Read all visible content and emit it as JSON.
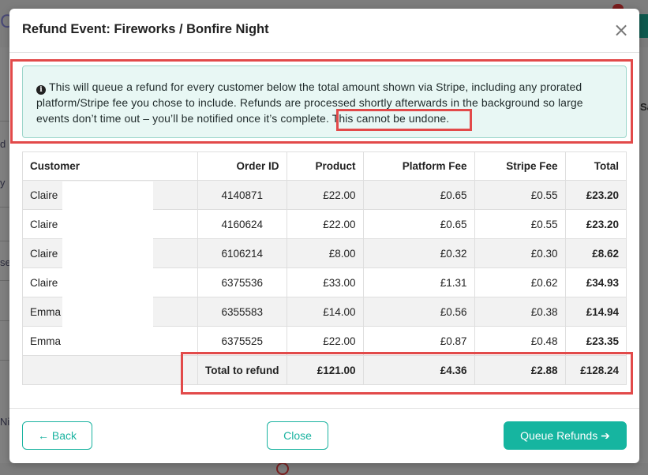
{
  "background": {
    "logo_letter": "C",
    "right_partial_text": "Sa",
    "left_partial_texts": [
      "d",
      "y",
      "se",
      "Ni"
    ]
  },
  "modal": {
    "title": "Refund Event: Fireworks / Bonfire Night",
    "close_icon": "×"
  },
  "alert": {
    "icon": "info-circle-icon",
    "text": "This will queue a refund for every customer below the total amount shown via Stripe, including any prorated platform/Stripe fee you chose to include. Refunds are processed shortly afterwards in the background so large events don’t time out – you’ll be notified once it’s complete.",
    "warning": "This cannot be undone."
  },
  "table": {
    "headers": [
      "Customer",
      "Order ID",
      "Product",
      "Platform Fee",
      "Stripe Fee",
      "Total"
    ],
    "rows": [
      {
        "customer": "Claire",
        "order_id": "4140871",
        "product": "£22.00",
        "platform_fee": "£0.65",
        "stripe_fee": "£0.55",
        "total": "£23.20"
      },
      {
        "customer": "Claire",
        "order_id": "4160624",
        "product": "£22.00",
        "platform_fee": "£0.65",
        "stripe_fee": "£0.55",
        "total": "£23.20"
      },
      {
        "customer": "Claire",
        "order_id": "6106214",
        "product": "£8.00",
        "platform_fee": "£0.32",
        "stripe_fee": "£0.30",
        "total": "£8.62"
      },
      {
        "customer": "Claire",
        "order_id": "6375536",
        "product": "£33.00",
        "platform_fee": "£1.31",
        "stripe_fee": "£0.62",
        "total": "£34.93"
      },
      {
        "customer": "Emma",
        "order_id": "6355583",
        "product": "£14.00",
        "platform_fee": "£0.56",
        "stripe_fee": "£0.38",
        "total": "£14.94"
      },
      {
        "customer": "Emma",
        "order_id": "6375525",
        "product": "£22.00",
        "platform_fee": "£0.87",
        "stripe_fee": "£0.48",
        "total": "£23.35"
      }
    ],
    "total_row": {
      "label": "Total to refund",
      "product": "£121.00",
      "platform_fee": "£4.36",
      "stripe_fee": "£2.88",
      "total": "£128.24"
    }
  },
  "footer": {
    "back_label": "← Back",
    "close_label": "Close",
    "queue_label": "Queue Refunds ➔"
  },
  "colors": {
    "accent": "#16b5a0",
    "highlight_box": "#e24a4a",
    "alert_bg": "#e8f7f4"
  }
}
